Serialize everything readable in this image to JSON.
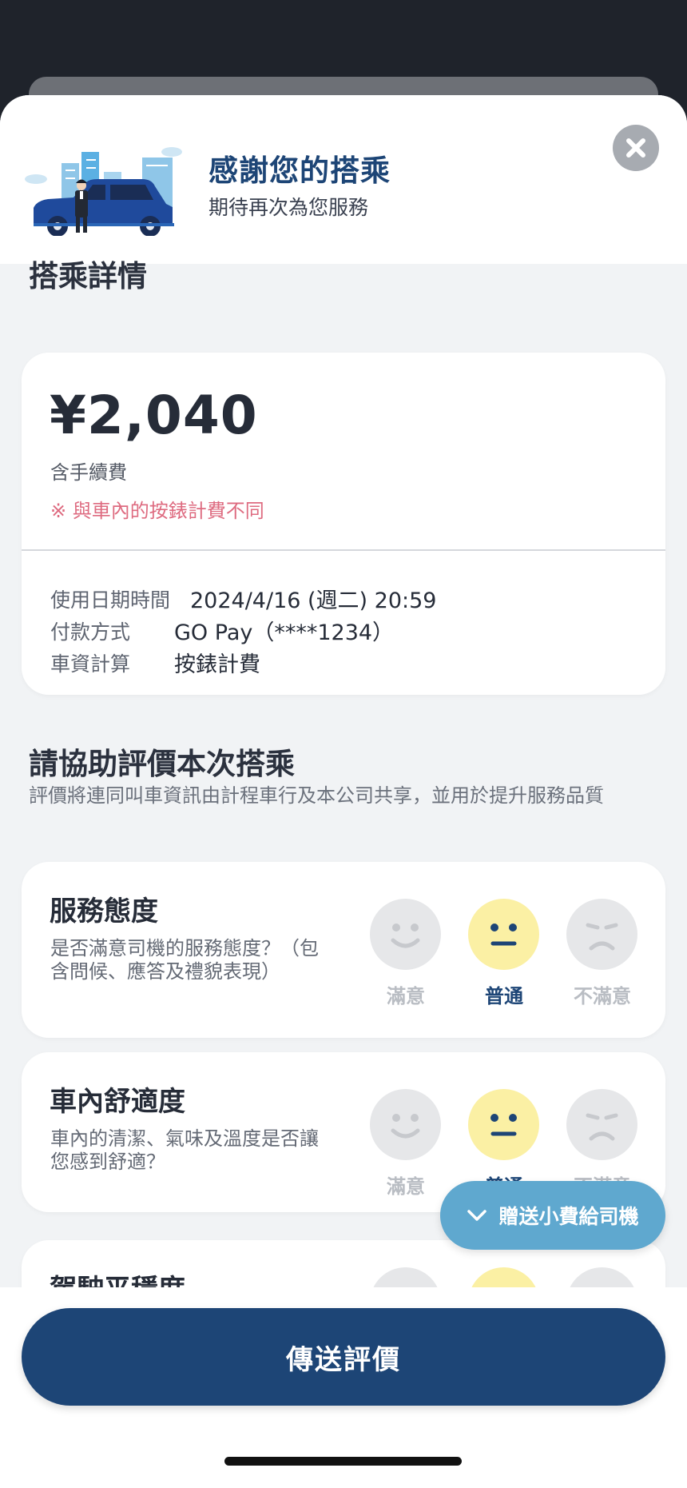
{
  "header": {
    "title": "感謝您的搭乘",
    "subtitle": "期待再次為您服務",
    "close_icon": "close-icon"
  },
  "ride_details": {
    "section_title": "搭乘詳情",
    "price": "¥2,040",
    "fee_note": "含手續費",
    "warning": "※ 與車內的按錶計費不同",
    "rows": [
      {
        "label": "使用日期時間",
        "value": "2024/4/16 (週二) 20:59"
      },
      {
        "label": "付款方式",
        "value": "GO Pay（****1234）"
      },
      {
        "label": "車資計算",
        "value": "按錶計費"
      }
    ]
  },
  "rating": {
    "section_title": "請協助評價本次搭乘",
    "description": "評價將連同叫車資訊由計程車行及本公司共享，並用於提升服務品質",
    "face_labels": [
      "滿意",
      "普通",
      "不滿意"
    ],
    "items": [
      {
        "title": "服務態度",
        "text": "是否滿意司機的服務態度？（包含問候、應答及禮貌表現）",
        "selected": "普通"
      },
      {
        "title": "車內舒適度",
        "text": "車內的清潔、氣味及溫度是否讓您感到舒適？",
        "selected": "普通"
      },
      {
        "title": "駕駛平穩度",
        "text": "",
        "selected": "普通"
      }
    ]
  },
  "tip_button": {
    "label": "贈送小費給司機",
    "icon": "chevron-down-icon"
  },
  "submit_button": {
    "label": "傳送評價"
  },
  "colors": {
    "brand_navy": "#1d4576",
    "tip_blue": "#5fa8cf",
    "warning_pink": "#de6b80",
    "selected_face": "#fbf0a4"
  }
}
